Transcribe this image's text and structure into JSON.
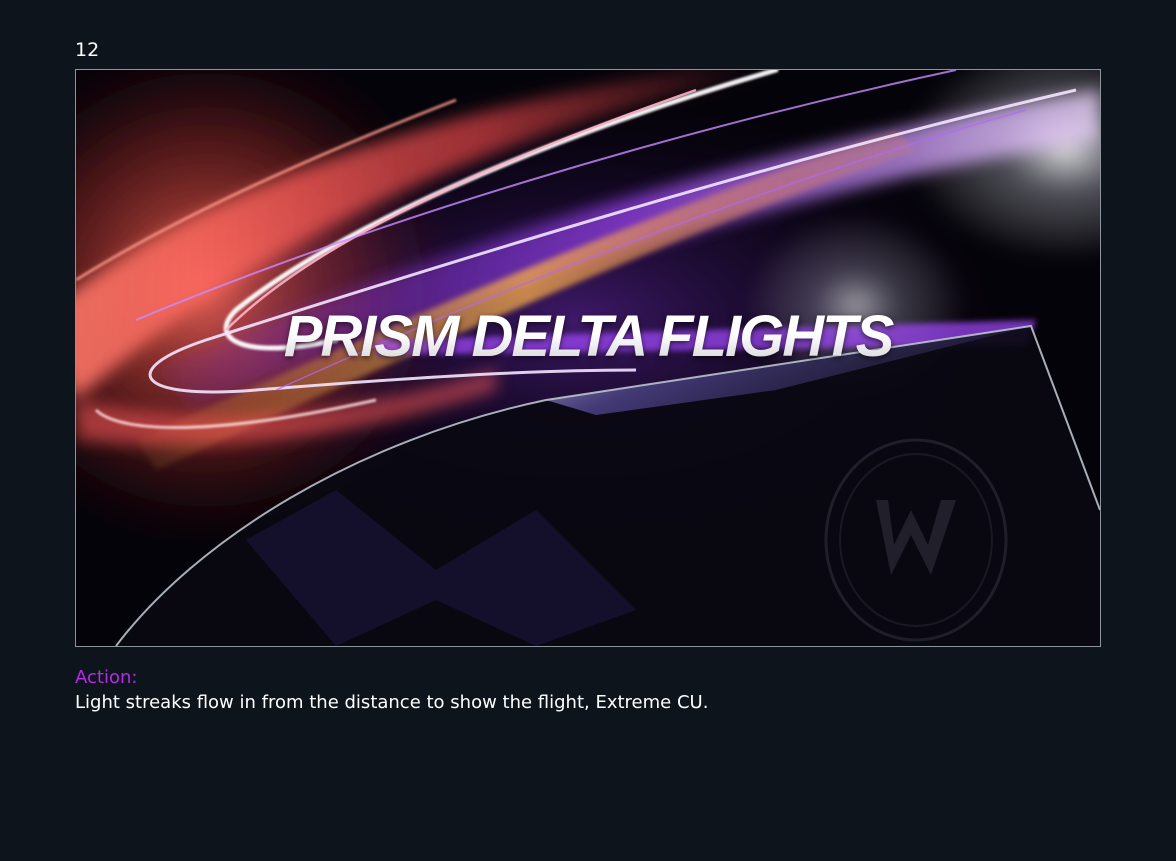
{
  "frame": {
    "number": "12",
    "headline": "PRISM DELTA FLIGHTS"
  },
  "caption": {
    "label": "Action:",
    "text": "Light streaks flow in from the distance to show the flight, Extreme CU."
  },
  "colors": {
    "page_background": "#0e141b",
    "action_label": "#b62ae8",
    "streak_red": "#ff5a5a",
    "streak_purple": "#9a3cff",
    "streak_orange": "#ffb347",
    "frame_border": "#8e949b"
  },
  "icons": {
    "logo": "w-circle-logo"
  }
}
